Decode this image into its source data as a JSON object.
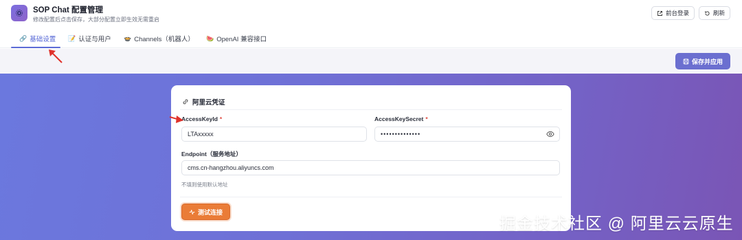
{
  "header": {
    "title": "SOP Chat 配置管理",
    "subtitle": "修改配置后点击保存，大部分配置立即生效无需重启",
    "frontend_login_label": "前台登录",
    "refresh_label": "刷新",
    "logo_icon": "gear-icon"
  },
  "tabs": [
    {
      "label": "基础设置",
      "icon": "🔗",
      "active": true
    },
    {
      "label": "认证与用户",
      "icon": "📝",
      "active": false
    },
    {
      "label": "Channels（机器人）",
      "icon": "🍲",
      "active": false
    },
    {
      "label": "OpenAI 兼容接口",
      "icon": "🍉",
      "active": false
    }
  ],
  "toolbar": {
    "save_label": "保存并应用"
  },
  "card": {
    "title": "阿里云凭证",
    "title_icon": "link-icon",
    "fields": {
      "access_key_id": {
        "label": "AccessKeyId",
        "required_mark": "*",
        "value": "LTAxxxxx"
      },
      "access_key_secret": {
        "label": "AccessKeySecret",
        "required_mark": "*",
        "value": "••••••••••••••"
      },
      "endpoint": {
        "label": "Endpoint（服务地址）",
        "value": "cms.cn-hangzhou.aliyuncs.com"
      }
    },
    "endpoint_hint": "不填则使用默认地址",
    "test_button_label": "测试连接"
  },
  "colors": {
    "accent": "#5b6ad6",
    "save_button": "#6b6fd0",
    "test_button": "#ea7c37",
    "gradient_start": "#6b78de",
    "gradient_end": "#7a55b5",
    "annotation_arrow": "#e0322b",
    "required": "#e0483e"
  },
  "watermark": "掘金技术社区 @ 阿里云云原生"
}
